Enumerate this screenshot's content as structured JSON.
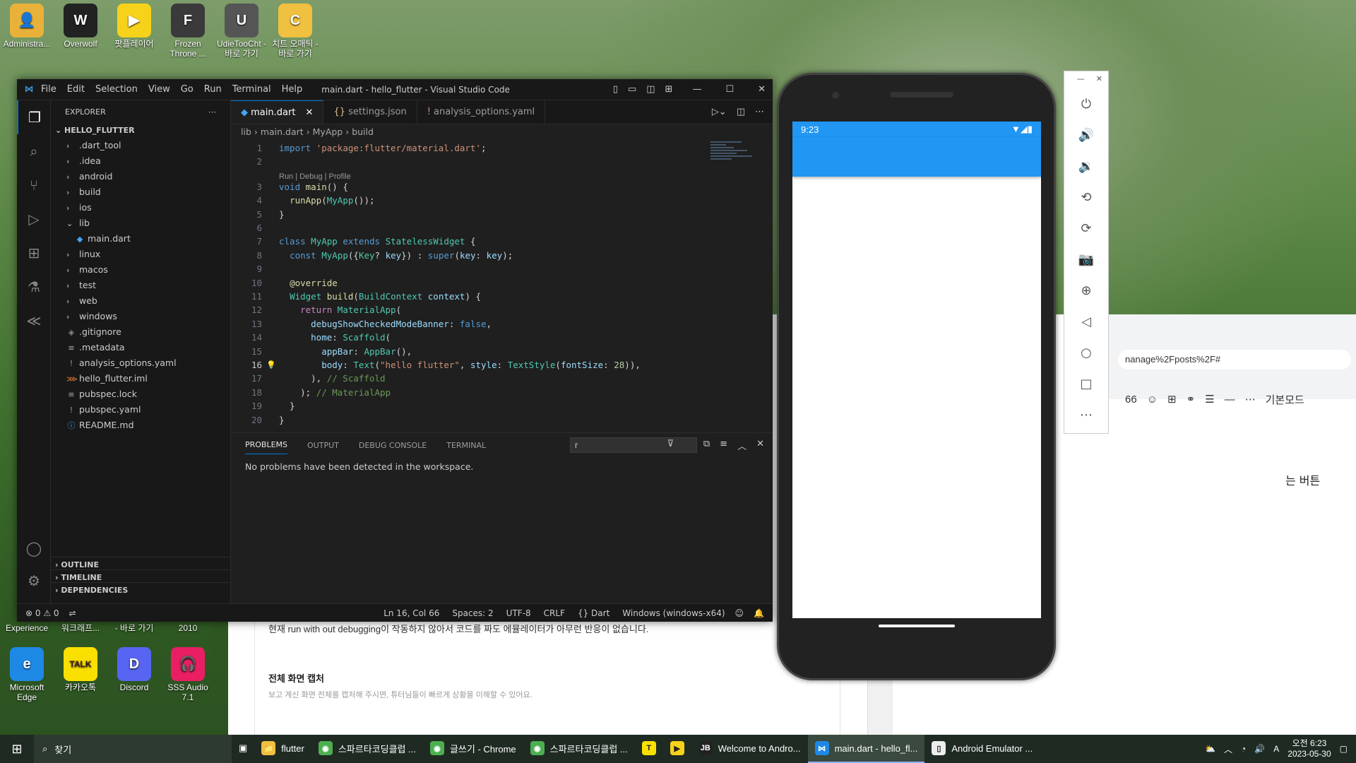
{
  "desktop": {
    "top_icons": [
      {
        "label": "Administra...",
        "color": "#e8b23a",
        "glyph": "👤"
      },
      {
        "label": "Overwolf",
        "color": "#222",
        "glyph": "W"
      },
      {
        "label": "팟플레이어",
        "color": "#f7d21a",
        "glyph": "▶"
      },
      {
        "label": "Frozen Throne ...",
        "color": "#3a3a3a",
        "glyph": "F"
      },
      {
        "label": "UdieTooCht - 바로 가기",
        "color": "#555",
        "glyph": "U"
      },
      {
        "label": "치트 오매틱 - 바로 가기",
        "color": "#f0c040",
        "glyph": "C"
      }
    ],
    "bottom_labels": [
      "Experience",
      "워크래프...",
      "- 바로 가기",
      "2010"
    ],
    "bottom_icons": [
      {
        "label": "Microsoft Edge",
        "color": "#1e88e5",
        "glyph": "e"
      },
      {
        "label": "카카오톡",
        "color": "#f9e000",
        "glyph": "TALK"
      },
      {
        "label": "Discord",
        "color": "#5865f2",
        "glyph": "D"
      },
      {
        "label": "SSS Audio 7.1",
        "color": "#e91e63",
        "glyph": "🎧"
      }
    ]
  },
  "browser": {
    "url": "nanage%2Fposts%2F#",
    "editor_mode": "기본모드",
    "button_text": "는 버튼",
    "post_line": "현재 run with out debugging이 작동하지 않아서 코드를 짜도 에뮬레이터가 아무런 반응이 없습니다.",
    "section_title": "전체 화면 캡처",
    "section_sub": "보고 계신 화면 전체를 캡처해 주시면, 튜터님들이 빠르게 상황을 이해할 수 있어요."
  },
  "vscode": {
    "menu": [
      "File",
      "Edit",
      "Selection",
      "View",
      "Go",
      "Run",
      "Terminal",
      "Help"
    ],
    "title": "main.dart - hello_flutter - Visual Studio Code",
    "explorer_label": "EXPLORER",
    "root": "HELLO_FLUTTER",
    "tree": [
      {
        "name": ".dart_tool",
        "type": "folder"
      },
      {
        "name": ".idea",
        "type": "folder"
      },
      {
        "name": "android",
        "type": "folder"
      },
      {
        "name": "build",
        "type": "folder"
      },
      {
        "name": "ios",
        "type": "folder"
      },
      {
        "name": "lib",
        "type": "folder-open"
      },
      {
        "name": "main.dart",
        "type": "dart"
      },
      {
        "name": "linux",
        "type": "folder"
      },
      {
        "name": "macos",
        "type": "folder"
      },
      {
        "name": "test",
        "type": "folder"
      },
      {
        "name": "web",
        "type": "folder"
      },
      {
        "name": "windows",
        "type": "folder"
      },
      {
        "name": ".gitignore",
        "type": "git"
      },
      {
        "name": ".metadata",
        "type": "file"
      },
      {
        "name": "analysis_options.yaml",
        "type": "yaml"
      },
      {
        "name": "hello_flutter.iml",
        "type": "iml"
      },
      {
        "name": "pubspec.lock",
        "type": "file"
      },
      {
        "name": "pubspec.yaml",
        "type": "yaml"
      },
      {
        "name": "README.md",
        "type": "info"
      }
    ],
    "sections": [
      "OUTLINE",
      "TIMELINE",
      "DEPENDENCIES"
    ],
    "tabs": [
      {
        "label": "main.dart",
        "icon": "◆",
        "active": true
      },
      {
        "label": "settings.json",
        "icon": "{}",
        "active": false
      },
      {
        "label": "analysis_options.yaml",
        "icon": "!",
        "active": false
      }
    ],
    "breadcrumb": [
      "lib",
      "main.dart",
      "MyApp",
      "build"
    ],
    "codelens": "Run | Debug | Profile",
    "code_lines": [
      {
        "n": "1",
        "html": "<span class=\"kw\">import</span> <span class=\"st\">'package:flutter/material.dart'</span>;"
      },
      {
        "n": "2",
        "html": ""
      },
      {
        "n": "3",
        "html": "<span class=\"kw\">void</span> <span class=\"fn\">main</span>() {"
      },
      {
        "n": "4",
        "html": "  <span class=\"fn\">runApp</span>(<span class=\"cl\">MyApp</span>());"
      },
      {
        "n": "5",
        "html": "}"
      },
      {
        "n": "6",
        "html": ""
      },
      {
        "n": "7",
        "html": "<span class=\"kw\">class</span> <span class=\"cl\">MyApp</span> <span class=\"kw\">extends</span> <span class=\"cl\">StatelessWidget</span> {"
      },
      {
        "n": "8",
        "html": "  <span class=\"kw\">const</span> <span class=\"cl\">MyApp</span>({<span class=\"cl\">Key</span>? <span class=\"pm\">key</span>}) : <span class=\"kw\">super</span>(<span class=\"pm\">key</span>: <span class=\"pm\">key</span>);"
      },
      {
        "n": "9",
        "html": ""
      },
      {
        "n": "10",
        "html": "  <span class=\"at\">@override</span>"
      },
      {
        "n": "11",
        "html": "  <span class=\"cl\">Widget</span> <span class=\"fn\">build</span>(<span class=\"cl\">BuildContext</span> <span class=\"pm\">context</span>) {"
      },
      {
        "n": "12",
        "html": "    <span class=\"ctl\">return</span> <span class=\"cl\">MaterialApp</span>("
      },
      {
        "n": "13",
        "html": "      <span class=\"pm\">debugShowCheckedModeBanner</span>: <span class=\"kw\">false</span>,"
      },
      {
        "n": "14",
        "html": "      <span class=\"pm\">home</span>: <span class=\"cl\">Scaffold</span>("
      },
      {
        "n": "15",
        "html": "        <span class=\"pm\">appBar</span>: <span class=\"cl\">AppBar</span>(),"
      },
      {
        "n": "16",
        "html": "        <span class=\"pm\">body</span>: <span class=\"cl\">Text</span>(<span class=\"st\">\"hello flutter\"</span>, <span class=\"pm\">style</span>: <span class=\"cl\">TextStyle</span>(<span class=\"pm\">fontSize</span>: <span class=\"nu\">28</span>)),"
      },
      {
        "n": "17",
        "html": "      ), <span class=\"cm\">// Scaffold</span>"
      },
      {
        "n": "18",
        "html": "    ); <span class=\"cm\">// MaterialApp</span>"
      },
      {
        "n": "19",
        "html": "  }"
      },
      {
        "n": "20",
        "html": "}"
      }
    ],
    "panel_tabs": [
      "PROBLEMS",
      "OUTPUT",
      "DEBUG CONSOLE",
      "TERMINAL"
    ],
    "filter_value": "r",
    "panel_message": "No problems have been detected in the workspace.",
    "status_left": "⊗ 0 ⚠ 0",
    "status_right": [
      "Ln 16, Col 66",
      "Spaces: 2",
      "UTF-8",
      "CRLF",
      "{} Dart",
      "Windows (windows-x64)"
    ]
  },
  "phone": {
    "time": "9:23",
    "appbar_color": "#2196f3"
  },
  "emulator_controls": [
    "power-icon",
    "volume-up-icon",
    "volume-down-icon",
    "rotate-left-icon",
    "rotate-right-icon",
    "camera-icon",
    "zoom-icon",
    "back-icon",
    "home-icon",
    "overview-icon",
    "more-icon"
  ],
  "taskbar": {
    "search_label": "찾기",
    "items": [
      {
        "label": "flutter",
        "color": "#f0c040",
        "glyph": "📁"
      },
      {
        "label": "스파르타코딩클럽 ...",
        "color": "#4caf50",
        "glyph": "◉"
      },
      {
        "label": "글쓰기 - Chrome",
        "color": "#4caf50",
        "glyph": "◉"
      },
      {
        "label": "스파르타코딩클럽 ...",
        "color": "#4caf50",
        "glyph": "◉"
      },
      {
        "label": "",
        "color": "#f9e000",
        "glyph": "T"
      },
      {
        "label": "",
        "color": "#f7d21a",
        "glyph": "▶"
      },
      {
        "label": "Welcome to Andro...",
        "color": "#222",
        "glyph": "JB"
      },
      {
        "label": "main.dart - hello_fl...",
        "color": "#1e88e5",
        "glyph": "⋈"
      },
      {
        "label": "Android Emulator ...",
        "color": "#eee",
        "glyph": "▯"
      }
    ],
    "clock_time": "오전 6:23",
    "clock_date": "2023-05-30"
  }
}
